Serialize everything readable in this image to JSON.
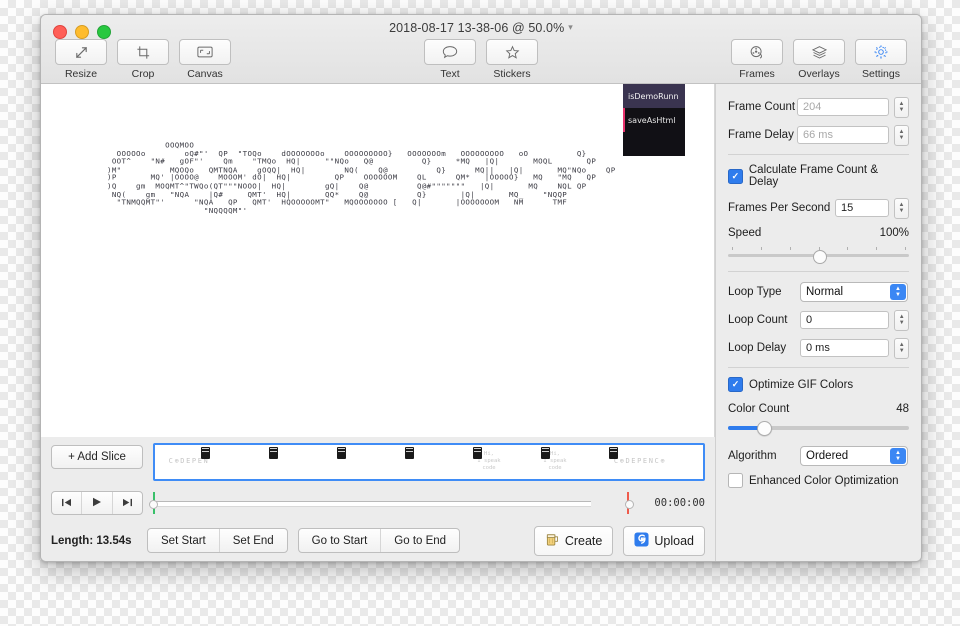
{
  "window": {
    "title": "2018-08-17 13-38-06 @ 50.0%",
    "title_chevron": "chevron-down-icon"
  },
  "toolbar": {
    "left": [
      {
        "label": "Resize",
        "icon": "resize-arrows-icon"
      },
      {
        "label": "Crop",
        "icon": "crop-icon"
      },
      {
        "label": "Canvas",
        "icon": "canvas-icon"
      }
    ],
    "middle": [
      {
        "label": "Text",
        "icon": "speech-bubble-icon"
      },
      {
        "label": "Stickers",
        "icon": "star-icon"
      }
    ],
    "right": [
      {
        "label": "Frames",
        "icon": "film-reel-icon",
        "active": false
      },
      {
        "label": "Overlays",
        "icon": "layers-icon",
        "active": false
      },
      {
        "label": "Settings",
        "icon": "gear-icon",
        "active": true
      }
    ]
  },
  "canvas": {
    "ascii_art": "            OOQMOO                                                                \n  OOOOOo        oQ#\"'  QP  \"TOQo    dOOOOOOOo    OOOOOOOOO}   OOOOOOOm   OOOOOOOOO   oO          Q}\n OOT^    \"N#   gOF\"'    Qm    \"TMQo  HQ|     \"\"NQo   Q@          Q}     *MQ   |Q|       MOQL       QP\n)M\"          MQOQo   QMTNQA    gOQQ|  HQ|        NQ(    Q@          Q}      MQ||   |Q|       MQ\"NQo    QP\n)P       MQ' |OOOO@    MOOOM' dO|  HQ|         QP    OOOOOOM    QL      QM*   |OOOOO}   MQ   \"MQ   QP\n)Q    gm  MOQMT^\"TWQo(QT\"\"\"NOOO|  HQ|        gQ|    Q@          Q@#\"\"\"\"\"\"\"   |Q|       MQ    NQL QP\n NQ(    gm   \"NQA    |Q#     QMT'  HQ|       QQ*    Q@          Q}       |Q|       MQ_    \"NQQP\n  \"TNMQQMT\"'      \"NQA   QP   QMT'  HQOOOOOMT\"   MQOOOOOOO [   Q|       |OOOOOOOM   NM      TMF\n                    \"NQQQQM\"'",
    "code_popup": {
      "items": [
        {
          "text": "isDemoRunn",
          "selected": true,
          "bar_color": "#3a3450"
        },
        {
          "text": "saveAsHtml",
          "selected": false,
          "bar_color": "#e8336d"
        }
      ],
      "background": "#111015"
    }
  },
  "timeline": {
    "add_slice_label": "+ Add Slice",
    "frames_text": [
      "C⊕DEPEN",
      "",
      "",
      "",
      "Hi,\nI speak\ncode",
      "Hi,\nI speak\ncode",
      "C⊕DEPENC⊕DEPENC⊕"
    ],
    "slice_marker_icon": "clapperboard-icon",
    "transport": {
      "skip_start": "skip-to-start-icon",
      "play": "play-icon",
      "skip_end": "skip-to-end-icon"
    },
    "timecode": "00:00:00",
    "start_marker_color": "#39c06a",
    "end_marker_color": "#ef5b4c",
    "length_label": "Length: 13.54s",
    "trim_buttons": [
      "Set Start",
      "Set End"
    ],
    "goto_buttons": [
      "Go to Start",
      "Go to End"
    ],
    "create_label": "Create",
    "create_icon": "beer-mug-icon",
    "upload_label": "Upload",
    "upload_icon": "gfycat-icon"
  },
  "settings": {
    "frame_count": {
      "label": "Frame Count",
      "value": "204",
      "dimmed": true
    },
    "frame_delay": {
      "label": "Frame Delay",
      "value": "66 ms",
      "dimmed": true
    },
    "calculate": {
      "label": "Calculate Frame Count & Delay",
      "checked": true
    },
    "fps": {
      "label": "Frames Per Second",
      "value": "15"
    },
    "speed": {
      "label": "Speed",
      "value": "100%",
      "position_pct": 50
    },
    "loop_type": {
      "label": "Loop Type",
      "value": "Normal"
    },
    "loop_count": {
      "label": "Loop Count",
      "value": "0"
    },
    "loop_delay": {
      "label": "Loop Delay",
      "value": "0 ms"
    },
    "optimize": {
      "label": "Optimize GIF Colors",
      "checked": true
    },
    "color_count": {
      "label": "Color Count",
      "value": "48",
      "position_pct": 19
    },
    "algorithm": {
      "label": "Algorithm",
      "value": "Ordered"
    },
    "enhanced": {
      "label": "Enhanced Color Optimization",
      "checked": false
    },
    "accent_color": "#2f7ced"
  }
}
